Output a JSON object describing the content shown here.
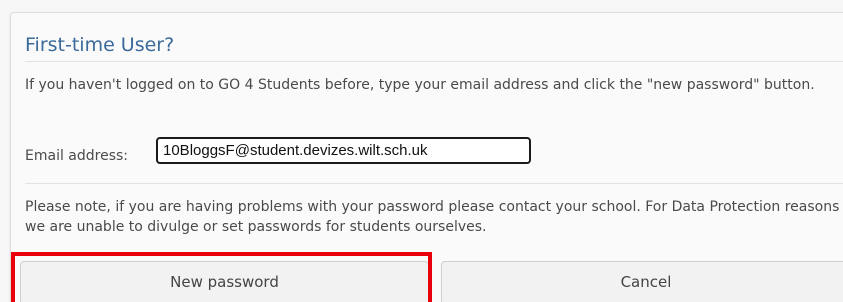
{
  "dialog": {
    "title": "First-time User?",
    "intro_text": "If you haven't logged on to GO 4 Students before, type your email address and click the \"new password\" button.",
    "email_label": "Email address:",
    "email_value": "10BloggsF@student.devizes.wilt.sch.uk",
    "note_text": "Please note, if you are having problems with your password please contact your school. For Data Protection reasons we are unable to divulge or set passwords for students ourselves.",
    "new_password_label": "New password",
    "cancel_label": "Cancel"
  },
  "colors": {
    "title": "#3b6a9a",
    "highlight": "#e8000c",
    "button_bg": "#f2f2f2"
  }
}
